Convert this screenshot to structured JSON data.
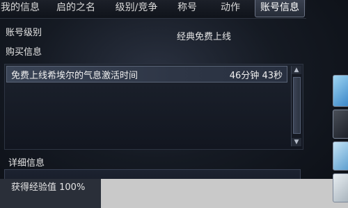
{
  "tabs": [
    {
      "label": "我的信息",
      "active": false
    },
    {
      "label": "启的之名",
      "active": false
    },
    {
      "label": "级别/竞争",
      "active": false
    },
    {
      "label": "称号",
      "active": false
    },
    {
      "label": "动作",
      "active": false
    },
    {
      "label": "账号信息",
      "active": true
    }
  ],
  "account": {
    "level_label": "账号级别",
    "level_value": "经典免费上线",
    "purchase_label": "购买信息"
  },
  "purchase_list": [
    {
      "name": "免费上线希埃尔的气息激活时间",
      "time": "46分钟 43秒"
    }
  ],
  "detail": {
    "label": "详细信息",
    "exp_label": "获得经验值 100%"
  },
  "icons": {
    "scroll_up": "scroll-up-arrow-icon",
    "scroll_down": "scroll-down-arrow-icon",
    "side_icons": [
      "item-icon-blue",
      "item-icon-dark",
      "item-icon-blue-2",
      "item-icon-light"
    ]
  }
}
